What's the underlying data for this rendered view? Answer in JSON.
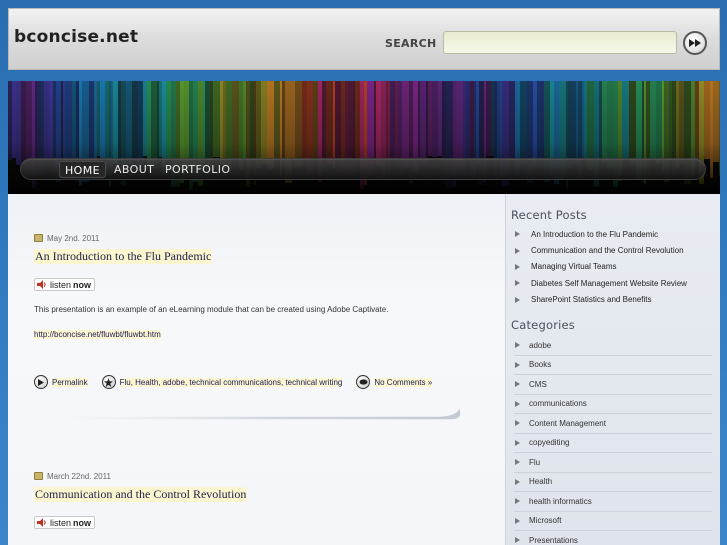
{
  "header": {
    "site_title": "bconcise.net",
    "search_label": "SEARCH",
    "search_value": "",
    "search_placeholder": ""
  },
  "nav": {
    "items": [
      {
        "label": "HOME",
        "active": true
      },
      {
        "label": "ABOUT",
        "active": false
      },
      {
        "label": "PORTFOLIO",
        "active": false
      }
    ]
  },
  "posts": [
    {
      "date": "May 2nd. 2011",
      "title": "An Introduction to the Flu Pandemic",
      "listen_label": "listen",
      "listen_bold": "now",
      "excerpt": "This presentation is an example of an eLearning module that can be created using Adobe Captivate.",
      "link": "http://bconcise.net/fluwbt/fluwbt.htm",
      "permalink_label": "Permalink",
      "tags": "Flu, Health, adobe, technical communications, technical writing",
      "comments": "No Comments »"
    },
    {
      "date": "March 22nd. 2011",
      "title": "Communication and the Control Revolution",
      "listen_label": "listen",
      "listen_bold": "now"
    }
  ],
  "sidebar": {
    "recent_heading": "Recent Posts",
    "recent_posts": [
      "An Introduction to the Flu Pandemic",
      "Communication and the Control Revolution",
      "Managing Virtual Teams",
      "Diabetes Self Management Website Review",
      "SharePoint Statistics and Benefits"
    ],
    "categories_heading": "Categories",
    "categories": [
      "adobe",
      "Books",
      "CMS",
      "communications",
      "Content Management",
      "copyediting",
      "Flu",
      "Health",
      "health informatics",
      "Microsoft",
      "Presentations"
    ]
  },
  "colors": {
    "accent_highlight": "#fbf6cf",
    "link_text": "#1d1f48",
    "page_background": "#2f78bd"
  }
}
